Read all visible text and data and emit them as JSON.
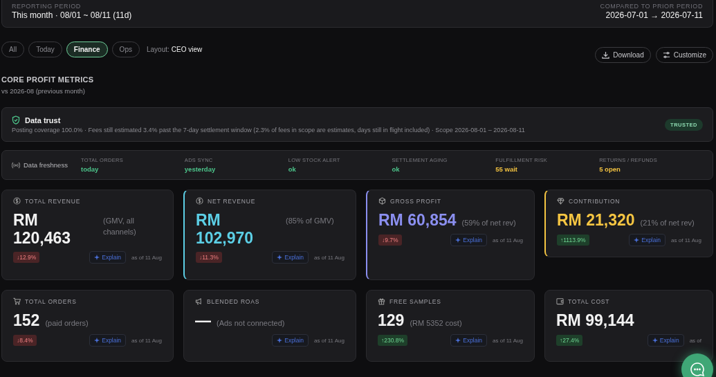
{
  "period": {
    "label": "REPORTING PERIOD",
    "value": "This month · 08/01 ~ 08/11 (11d)",
    "compare_label": "COMPARED TO PRIOR PERIOD",
    "compare_value": "2026-07-01 → 2026-07-11"
  },
  "filters": [
    {
      "label": "All",
      "selected": false
    },
    {
      "label": "Today",
      "selected": false
    },
    {
      "label": "Finance",
      "selected": true
    },
    {
      "label": "Ops",
      "selected": false
    }
  ],
  "layout": {
    "label": "Layout:",
    "value": "CEO view"
  },
  "actions": [
    "Download",
    "Customize"
  ],
  "section": {
    "title": "CORE PROFIT METRICS",
    "subtitle": "vs 2026-08 (previous month)"
  },
  "trust": {
    "title": "Data trust",
    "text": "Posting coverage 100.0% · Fees still estimated 3.4% past the 7-day settlement window (2.3% of fees in scope are estimates, days still in flight included) · Scope 2026-08-01 – 2026-08-11",
    "badge": "TRUSTED"
  },
  "freshness": {
    "title": "Data freshness",
    "items": [
      {
        "label": "TOTAL ORDERS",
        "value": "today",
        "warning": false
      },
      {
        "label": "ADS SYNC",
        "value": "yesterday",
        "warning": false
      },
      {
        "label": "LOW STOCK ALERT",
        "value": "ok",
        "warning": false
      },
      {
        "label": "SETTLEMENT AGING",
        "value": "ok",
        "warning": false
      },
      {
        "label": "FULFILLMENT RISK",
        "value": "55 wait",
        "warning": true
      },
      {
        "label": "RETURNS / REFUNDS",
        "value": "5 open",
        "warning": true
      }
    ]
  },
  "metrics": [
    {
      "label": "TOTAL REVENUE",
      "value": "RM 120,463",
      "note": "(GMV, all channels)",
      "delta": "↓12.9%",
      "up": false,
      "color": "#f2f2f2",
      "accent": false,
      "explain": "Explain",
      "asof": "as of 11 Aug"
    },
    {
      "label": "NET REVENUE",
      "value": "RM 102,970",
      "note": "(85% of GMV)",
      "delta": "↓11.3%",
      "up": false,
      "color": "#5ccfe6",
      "accent": true,
      "explain": "Explain",
      "asof": "as of 11 Aug"
    },
    {
      "label": "GROSS PROFIT",
      "value": "RM 60,854",
      "note": "(59% of net rev)",
      "delta": "↓9.7%",
      "up": false,
      "color": "#8b8ff0",
      "accent": true,
      "explain": "Explain",
      "asof": "as of 11 Aug"
    },
    {
      "label": "CONTRIBUTION",
      "value": "RM 21,320",
      "note": "(21% of net rev)",
      "delta": "↑1113.9%",
      "up": true,
      "color": "#f5c542",
      "accent": true,
      "explain": "Explain",
      "asof": "as of 11 Aug"
    },
    {
      "label": "TOTAL ORDERS",
      "value": "152",
      "note": "(paid orders)",
      "delta": "↓8.4%",
      "up": false,
      "color": "#f2f2f2",
      "accent": false,
      "explain": "Explain",
      "asof": "as of 11 Aug"
    },
    {
      "label": "BLENDED ROAS",
      "value": "—",
      "note": "(Ads not connected)",
      "color": "#f2f2f2",
      "accent": false,
      "explain": "Explain",
      "asof": "as of 11 Aug"
    },
    {
      "label": "FREE SAMPLES",
      "value": "129",
      "note": "(RM 5352 cost)",
      "delta": "↑230.8%",
      "up": true,
      "color": "#f2f2f2",
      "accent": false,
      "explain": "Explain",
      "asof": "as of 11 Aug"
    },
    {
      "label": "TOTAL COST",
      "value": "RM 99,144",
      "delta": "↑27.4%",
      "up": true,
      "color": "#f2f2f2",
      "accent": false,
      "explain": "Explain",
      "asof": "as of"
    }
  ]
}
